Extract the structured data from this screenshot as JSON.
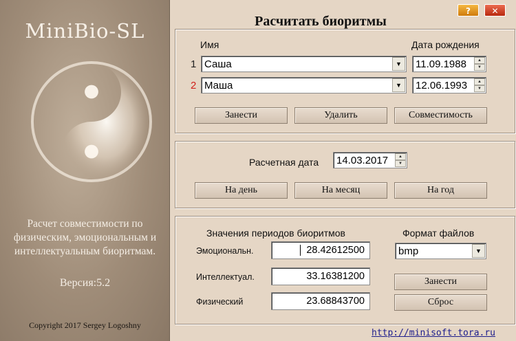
{
  "app": {
    "name": "MiniBio-SL",
    "description_lines": [
      "Расчет совместимости по",
      "физическим, эмоциональным и",
      "интеллектуальным биоритмам."
    ],
    "version": "Версия:5.2",
    "copyright": "Copyright 2017 Sergey Logoshny",
    "url": "http://minisoft.tora.ru"
  },
  "titlebar": {
    "help_label": "?",
    "close_label": "✕"
  },
  "header": {
    "title": "Расчитать биоритмы"
  },
  "people": {
    "name_header": "Имя",
    "birth_header": "Дата рождения",
    "rows": [
      {
        "index": "1",
        "name": "Саша",
        "birthdate": "11.09.1988",
        "index_color": "#222222"
      },
      {
        "index": "2",
        "name": "Маша",
        "birthdate": "12.06.1993",
        "index_color": "#d0201a"
      }
    ],
    "buttons": {
      "add": "Занести",
      "delete": "Удалить",
      "compat": "Совместимость"
    }
  },
  "calc": {
    "date_label": "Расчетная дата",
    "date_value": "14.03.2017",
    "buttons": {
      "day": "На день",
      "month": "На месяц",
      "year": "На год"
    }
  },
  "periods": {
    "title": "Значения периодов биоритмов",
    "rows": [
      {
        "label": "Эмоциональн.",
        "value": "28.42612500"
      },
      {
        "label": "Интеллектуал.",
        "value": "33.16381200"
      },
      {
        "label": "Физический",
        "value": "23.68843700"
      }
    ]
  },
  "file_format": {
    "title": "Формат файлов",
    "selected": "bmp",
    "buttons": {
      "save": "Занести",
      "reset": "Сброс"
    }
  },
  "icons": {
    "logo": "yin-yang-icon",
    "dropdown": "chevron-down-icon",
    "spin": "spin-arrows-icon"
  }
}
